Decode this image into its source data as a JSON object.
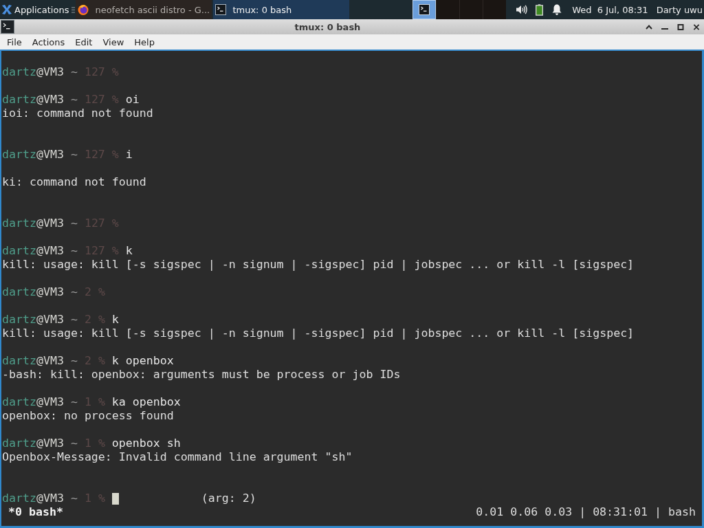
{
  "taskbar": {
    "menu": {
      "label": "Applications"
    },
    "tasks": [
      {
        "label": "neofetch ascii distro - G...",
        "kind": "browser",
        "selected": false
      },
      {
        "label": "tmux: 0 bash",
        "kind": "terminal",
        "selected": true
      }
    ],
    "workspaces": [
      {
        "selected": true,
        "occupied": true
      },
      {
        "selected": false,
        "occupied": false
      },
      {
        "selected": false,
        "occupied": false
      },
      {
        "selected": false,
        "occupied": false
      }
    ],
    "clock": "Wed  6 Jul, 08:31",
    "user": "Darty uwu"
  },
  "window": {
    "title": "tmux: 0 bash"
  },
  "menu_bar": [
    "File",
    "Actions",
    "Edit",
    "View",
    "Help"
  ],
  "terminal": {
    "lines": [
      {
        "kind": "blank"
      },
      {
        "kind": "prompt",
        "user": "dartz",
        "host": "@VM3",
        "dir": "~",
        "status": "127",
        "symbol": "%"
      },
      {
        "kind": "blank"
      },
      {
        "kind": "prompt",
        "user": "dartz",
        "host": "@VM3",
        "dir": "~",
        "status": "127",
        "symbol": "%",
        "command": "oi"
      },
      {
        "kind": "output",
        "text": "ioi: command not found"
      },
      {
        "kind": "blank"
      },
      {
        "kind": "blank"
      },
      {
        "kind": "prompt",
        "user": "dartz",
        "host": "@VM3",
        "dir": "~",
        "status": "127",
        "symbol": "%",
        "command": "i"
      },
      {
        "kind": "blank"
      },
      {
        "kind": "output",
        "text": "ki: command not found"
      },
      {
        "kind": "blank"
      },
      {
        "kind": "blank"
      },
      {
        "kind": "prompt",
        "user": "dartz",
        "host": "@VM3",
        "dir": "~",
        "status": "127",
        "symbol": "%"
      },
      {
        "kind": "blank"
      },
      {
        "kind": "prompt",
        "user": "dartz",
        "host": "@VM3",
        "dir": "~",
        "status": "127",
        "symbol": "%",
        "command": "k"
      },
      {
        "kind": "output",
        "text": "kill: usage: kill [-s sigspec | -n signum | -sigspec] pid | jobspec ... or kill -l [sigspec]"
      },
      {
        "kind": "blank"
      },
      {
        "kind": "prompt",
        "user": "dartz",
        "host": "@VM3",
        "dir": "~",
        "status": "2",
        "symbol": "%"
      },
      {
        "kind": "blank"
      },
      {
        "kind": "prompt",
        "user": "dartz",
        "host": "@VM3",
        "dir": "~",
        "status": "2",
        "symbol": "%",
        "command": "k"
      },
      {
        "kind": "output",
        "text": "kill: usage: kill [-s sigspec | -n signum | -sigspec] pid | jobspec ... or kill -l [sigspec]"
      },
      {
        "kind": "blank"
      },
      {
        "kind": "prompt",
        "user": "dartz",
        "host": "@VM3",
        "dir": "~",
        "status": "2",
        "symbol": "%",
        "command": "k openbox"
      },
      {
        "kind": "output",
        "text": "-bash: kill: openbox: arguments must be process or job IDs"
      },
      {
        "kind": "blank"
      },
      {
        "kind": "prompt",
        "user": "dartz",
        "host": "@VM3",
        "dir": "~",
        "status": "1",
        "symbol": "%",
        "command": "ka openbox"
      },
      {
        "kind": "output",
        "text": "openbox: no process found"
      },
      {
        "kind": "blank"
      },
      {
        "kind": "prompt",
        "user": "dartz",
        "host": "@VM3",
        "dir": "~",
        "status": "1",
        "symbol": "%",
        "command": "openbox sh"
      },
      {
        "kind": "output",
        "text": "Openbox-Message: Invalid command line argument \"sh\""
      },
      {
        "kind": "blank"
      },
      {
        "kind": "blank"
      },
      {
        "kind": "current",
        "user": "dartz",
        "host": "@VM3",
        "dir": "~",
        "status": "1",
        "symbol": "%",
        "hint": "(arg: 2)"
      }
    ],
    "status_bar": {
      "window": "*0 bash*",
      "info": "0.01 0.06 0.03 | 08:31:01 | bash"
    }
  }
}
